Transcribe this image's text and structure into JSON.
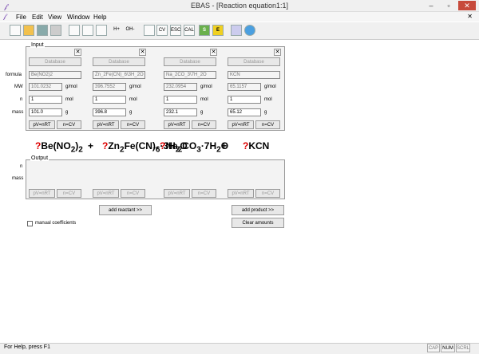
{
  "window": {
    "title": "EBAS - [Reaction equation1:1]",
    "minimize": "–",
    "maximize": "▫",
    "close": "✕"
  },
  "menu": [
    "File",
    "Edit",
    "View",
    "Window",
    "Help"
  ],
  "toolbar": [
    "new",
    "open",
    "save",
    "print",
    "table",
    "pane",
    "H+",
    "OH-",
    "PPH RAT",
    "CV",
    "ESC",
    "CAL",
    "S",
    "E",
    "help",
    "chat"
  ],
  "input_group": {
    "title": "Input"
  },
  "output_group": {
    "title": "Output"
  },
  "row_labels": {
    "formula": "formula",
    "mw": "MW",
    "n": "n",
    "mass": "mass"
  },
  "output_labels": {
    "n": "n",
    "mass": "mass"
  },
  "buttons": {
    "database": "Database",
    "pv": "pV=nRT",
    "ncv": "n=CV",
    "close": "✕"
  },
  "units": {
    "mw": "g/mol",
    "n": "mol",
    "mass": "g"
  },
  "compounds": [
    {
      "formula": "Be(NO2)2",
      "mw": "101.0232",
      "n": "1",
      "mass": "101.0"
    },
    {
      "formula": "Zn_2Fe(CN)_6\\3H_2O",
      "mw": "396.7552",
      "n": "1",
      "mass": "396.8"
    },
    {
      "formula": "Na_2CO_3\\7H_2O",
      "mw": "232.0954",
      "n": "1",
      "mass": "232.1"
    },
    {
      "formula": "KCN",
      "mw": "65.1157",
      "n": "1",
      "mass": "65.12"
    }
  ],
  "equation": {
    "c1": "Be(NO",
    "c1a": "2",
    "c1b": ")",
    "c1c": "2",
    "c2": "Zn",
    "c2a": "2",
    "c2b": "Fe(CN)",
    "c2c": "6",
    "c2d": "·3H",
    "c2e": "2",
    "c2f": "O",
    "c3": "Na",
    "c3a": "2",
    "c3b": "CO",
    "c3c": "3",
    "c3d": "·7H",
    "c3e": "2",
    "c3f": "O",
    "c4": "KCN",
    "q": "?",
    "plus": "+",
    "arrow": "→"
  },
  "actions": {
    "add_reactant": "add reactant >>",
    "add_product": "add product >>",
    "clear": "Clear amounts"
  },
  "manual": "manual coefficients",
  "status": {
    "text": "For Help, press F1",
    "cap": "CAP",
    "num": "NUM",
    "scrl": "SCRL"
  }
}
